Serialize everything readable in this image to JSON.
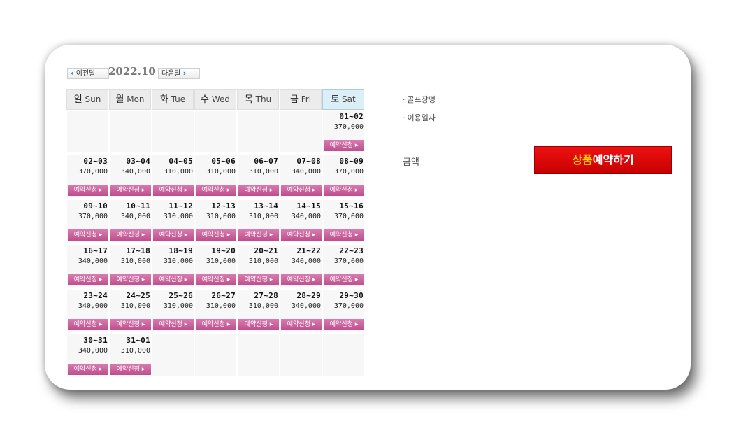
{
  "nav": {
    "prev_label": "이전달",
    "next_label": "다음달",
    "month": "2022.10"
  },
  "calendar": {
    "headers": [
      {
        "ko": "일",
        "en": "Sun"
      },
      {
        "ko": "월",
        "en": "Mon"
      },
      {
        "ko": "화",
        "en": "Tue"
      },
      {
        "ko": "수",
        "en": "Wed"
      },
      {
        "ko": "목",
        "en": "Thu"
      },
      {
        "ko": "금",
        "en": "Fri"
      },
      {
        "ko": "토",
        "en": "Sat"
      }
    ],
    "book_label": "예약신청",
    "weeks": [
      [
        null,
        null,
        null,
        null,
        null,
        null,
        {
          "range": "01~02",
          "price": "370,000"
        }
      ],
      [
        {
          "range": "02~03",
          "price": "370,000"
        },
        {
          "range": "03~04",
          "price": "340,000"
        },
        {
          "range": "04~05",
          "price": "310,000"
        },
        {
          "range": "05~06",
          "price": "310,000"
        },
        {
          "range": "06~07",
          "price": "310,000"
        },
        {
          "range": "07~08",
          "price": "340,000"
        },
        {
          "range": "08~09",
          "price": "370,000"
        }
      ],
      [
        {
          "range": "09~10",
          "price": "370,000"
        },
        {
          "range": "10~11",
          "price": "340,000"
        },
        {
          "range": "11~12",
          "price": "310,000"
        },
        {
          "range": "12~13",
          "price": "310,000"
        },
        {
          "range": "13~14",
          "price": "310,000"
        },
        {
          "range": "14~15",
          "price": "340,000"
        },
        {
          "range": "15~16",
          "price": "370,000"
        }
      ],
      [
        {
          "range": "16~17",
          "price": "340,000"
        },
        {
          "range": "17~18",
          "price": "310,000"
        },
        {
          "range": "18~19",
          "price": "310,000"
        },
        {
          "range": "19~20",
          "price": "310,000"
        },
        {
          "range": "20~21",
          "price": "310,000"
        },
        {
          "range": "21~22",
          "price": "340,000"
        },
        {
          "range": "22~23",
          "price": "370,000"
        }
      ],
      [
        {
          "range": "23~24",
          "price": "340,000"
        },
        {
          "range": "24~25",
          "price": "310,000"
        },
        {
          "range": "25~26",
          "price": "310,000"
        },
        {
          "range": "26~27",
          "price": "310,000"
        },
        {
          "range": "27~28",
          "price": "310,000"
        },
        {
          "range": "28~29",
          "price": "340,000"
        },
        {
          "range": "29~30",
          "price": "370,000"
        }
      ],
      [
        {
          "range": "30~31",
          "price": "340,000"
        },
        {
          "range": "31~01",
          "price": "310,000"
        },
        null,
        null,
        null,
        null,
        null
      ]
    ]
  },
  "info": {
    "golf_course_label": "골프장명",
    "use_date_label": "이용일자",
    "price_label": "금액",
    "book_button_part1": "상품",
    "book_button_part2": "예약하기"
  },
  "colors": {
    "accent_red": "#d00000",
    "book_pink": "#c95a97",
    "sat_header": "#dceef6"
  }
}
